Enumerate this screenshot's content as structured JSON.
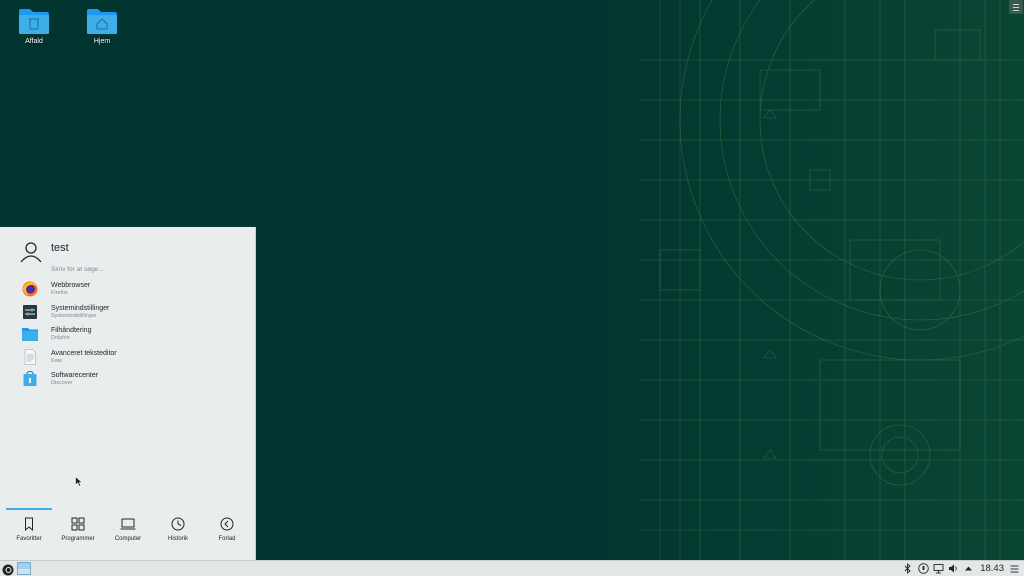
{
  "desktop": {
    "icons": [
      {
        "label": "Affald",
        "icon": "trash-folder-icon"
      },
      {
        "label": "Hjem",
        "icon": "home-folder-icon"
      }
    ]
  },
  "menu": {
    "user": "test",
    "search_placeholder": "Skriv for at søge...",
    "favorites": [
      {
        "title": "Webbrowser",
        "subtitle": "Firefox",
        "icon": "firefox-icon"
      },
      {
        "title": "Systemindstillinger",
        "subtitle": "Systemindstillinger",
        "icon": "settings-icon"
      },
      {
        "title": "Filhåndtering",
        "subtitle": "Dolphin",
        "icon": "dolphin-folder-icon"
      },
      {
        "title": "Avanceret teksteditor",
        "subtitle": "Kate",
        "icon": "text-editor-icon"
      },
      {
        "title": "Softwarecenter",
        "subtitle": "Discover",
        "icon": "discover-icon"
      }
    ],
    "tabs": [
      {
        "label": "Favoritter",
        "icon": "bookmark-icon",
        "active": true
      },
      {
        "label": "Programmer",
        "icon": "grid-icon"
      },
      {
        "label": "Computer",
        "icon": "laptop-icon"
      },
      {
        "label": "Historik",
        "icon": "clock-icon"
      },
      {
        "label": "Forlad",
        "icon": "back-arrow-icon"
      }
    ]
  },
  "taskbar": {
    "clock": "18.43",
    "tray_icons": [
      "bluetooth-icon",
      "updates-icon",
      "network-icon",
      "volume-icon",
      "expand-arrow-icon",
      "menu-icon"
    ]
  },
  "colors": {
    "wallpaper": "#02352f",
    "accent": "#3daee9",
    "folder": "#3daee9",
    "panel": "#e9edee"
  }
}
